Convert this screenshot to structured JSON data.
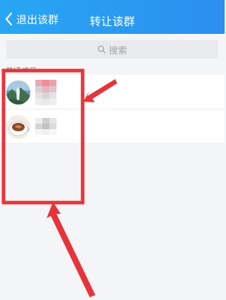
{
  "header": {
    "back_label": "退出该群",
    "title": "转让该群",
    "background": "#2b96f0"
  },
  "search": {
    "placeholder": "搜索"
  },
  "section": {
    "label": "普通成员"
  },
  "members": [
    {
      "avatar": "landscape-avatar"
    },
    {
      "avatar": "coffee-cup-avatar"
    }
  ],
  "colors": {
    "annotation_red": "#e8333a",
    "background": "#f4f5f7"
  }
}
